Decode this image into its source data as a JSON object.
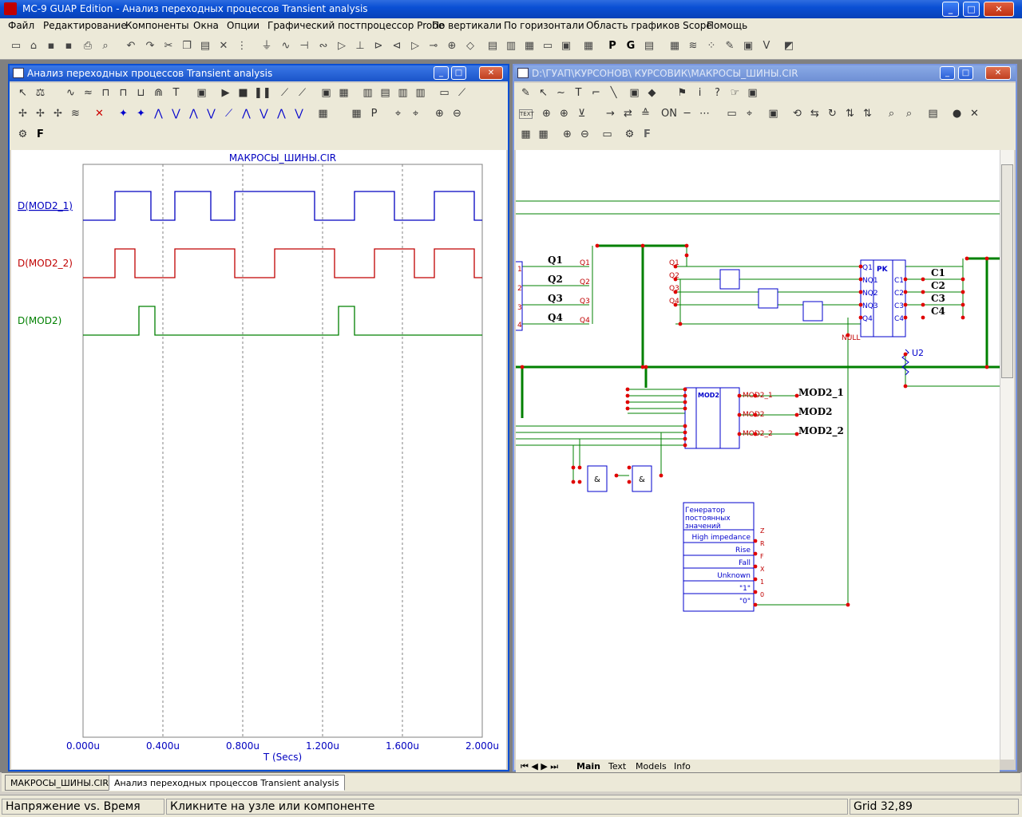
{
  "app": {
    "title": "MC-9 GUAP Edition - Анализ переходных процессов Transient analysis"
  },
  "menu": [
    "Файл",
    "Редактирование",
    "Компоненты",
    "Окна",
    "Опции",
    "Графический постпроцессор Probe",
    "По вертикали",
    "По горизонтали",
    "Область графиков Scope",
    "Помощь"
  ],
  "plot_window": {
    "title": "Анализ переходных процессов Transient analysis",
    "toolbar_F": "F",
    "plot_title": "МАКРОСЫ_ШИНЫ.CIR",
    "xlabel": "T (Secs)",
    "trace_labels": [
      "D(MOD2_1)",
      "D(MOD2_2)",
      "D(MOD2)"
    ]
  },
  "chart_data": {
    "type": "line",
    "title": "МАКРОСЫ_ШИНЫ.CIR",
    "xlabel": "T (Secs)",
    "x_tick_labels": [
      "0.000u",
      "0.400u",
      "0.800u",
      "1.200u",
      "1.600u",
      "2.000u"
    ],
    "xlim": [
      0,
      2.0
    ],
    "series": [
      {
        "name": "D(MOD2_1)",
        "color": "#0000c0",
        "edges": [
          0.16,
          0.34,
          0.46,
          0.64,
          0.76,
          1.16,
          1.36,
          1.56,
          1.76,
          1.96
        ]
      },
      {
        "name": "D(MOD2_2)",
        "color": "#c00000",
        "edges": [
          0.16,
          0.26,
          0.46,
          0.76,
          0.96,
          1.26,
          1.46,
          1.66,
          1.76,
          1.96
        ]
      },
      {
        "name": "D(MOD2)",
        "color": "#008000",
        "edges": [
          0.28,
          0.36,
          1.28,
          1.36
        ]
      }
    ]
  },
  "schematic_window": {
    "title": "D:\\ГУАП\\КУРСОНОВ\\ КУРСОВИК\\МАКРОСЫ_ШИНЫ.CIR",
    "toolbar_text": "TEXT",
    "toolbar_F": "F",
    "tabs": [
      "Main",
      "Text",
      "Models",
      "Info"
    ],
    "labels": {
      "q1": "Q1",
      "q2": "Q2",
      "q3": "Q3",
      "q4": "Q4",
      "c1": "C1",
      "c2": "C2",
      "c3": "C3",
      "c4": "C4",
      "pk": "PK",
      "mod2": "MOD2",
      "null": "NULL",
      "u2": "U2",
      "nq1": "NQ1",
      "nq2": "NQ2",
      "nq3": "NQ3",
      "mod2_1": "MOD2_1",
      "mod2_2": "MOD2_2",
      "and": "&",
      "gen_title_1": "Генератор",
      "gen_title_2": "постоянных",
      "gen_title_3": "значений",
      "gen_rows": [
        "High impedance",
        "Rise",
        "Fall",
        "Unknown",
        "\"1\"",
        "\"0\""
      ],
      "gen_pins": [
        "Z",
        "R",
        "F",
        "X",
        "1",
        "0"
      ],
      "pin_1": "1",
      "pin_2": "2",
      "pin_3": "3",
      "pin_4": "4"
    }
  },
  "doc_tabs": [
    "МАКРОСЫ_ШИНЫ.CIR",
    "Анализ переходных процессов Transient analysis"
  ],
  "status": {
    "left": "Напряжение vs. Время",
    "middle": "Кликните на узле или компоненте",
    "right": "Grid 32,89"
  }
}
